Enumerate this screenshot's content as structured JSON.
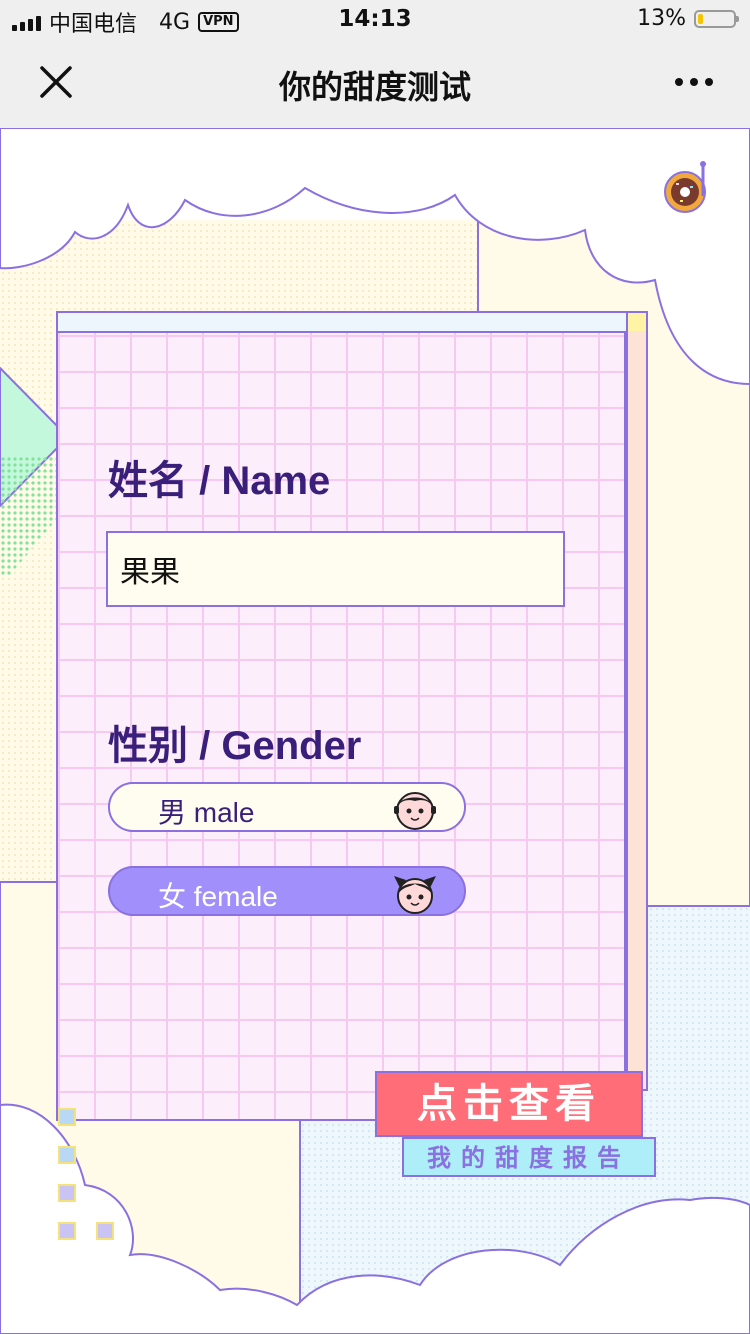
{
  "status_bar": {
    "carrier": "中国电信",
    "network": "4G",
    "vpn_label": "VPN",
    "time": "14:13",
    "battery_percent": "13%",
    "battery_level": 0.13
  },
  "nav": {
    "title": "你的甜度测试"
  },
  "form": {
    "name_label": "姓名 / Name",
    "name_value": "果果",
    "gender_label": "性别 / Gender",
    "gender_options": [
      {
        "label": "男 male",
        "selected": false
      },
      {
        "label": "女 female",
        "selected": true
      }
    ]
  },
  "cta": {
    "label": "点击查看",
    "sublabel": "我的甜度报告"
  },
  "colors": {
    "accent_purple": "#8a70e0",
    "title_purple": "#3a1f7a",
    "selected_fill": "#a190fb",
    "button_red": "#ff6d78",
    "button_sub_cyan": "#aeeef8",
    "grid_pink": "#fdeefb"
  }
}
